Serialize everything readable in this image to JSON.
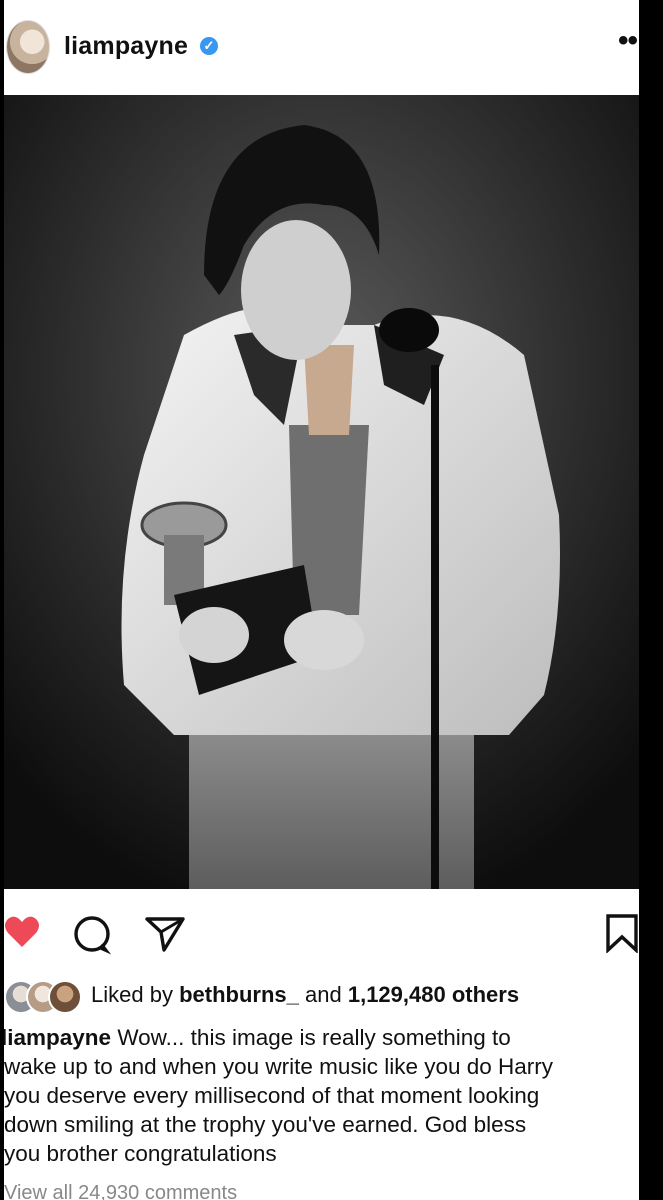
{
  "header": {
    "username": "liampayne",
    "verified_icon": "verified-badge-icon",
    "more_icon": "more-options-icon"
  },
  "photo": {
    "alt": "Black and white photo of a man in a white suit holding a gramophone trophy at a microphone stand"
  },
  "actions": {
    "like_icon": "heart-filled-icon",
    "like_color": "#ed4956",
    "comment_icon": "comment-icon",
    "share_icon": "share-paper-plane-icon",
    "save_icon": "bookmark-icon"
  },
  "likes": {
    "prefix": "Liked by",
    "user": "bethburns_",
    "joiner": "and",
    "count": "1,129,480 others"
  },
  "caption": {
    "author": "liampayne",
    "text": "Wow... this image is really something to\nwake up to and when you write music like you do Harry\nyou deserve every millisecond of that moment looking\ndown smiling at the trophy you've earned. God bless\nyou brother congratulations"
  },
  "comments": {
    "view_all": "View all 24,930 comments"
  }
}
